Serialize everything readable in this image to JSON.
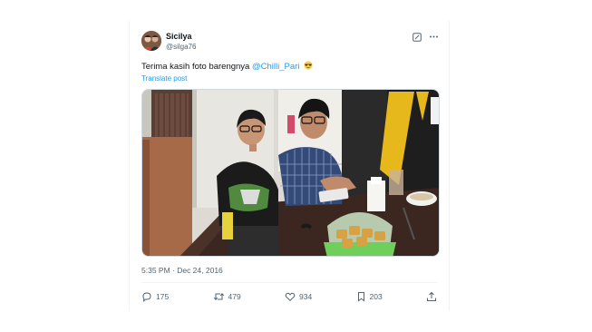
{
  "tweet": {
    "display_name": "Sicilya",
    "handle": "@silga76",
    "text_before": "Terima kasih foto barengnya ",
    "mention": "@Chilli_Pari",
    "emoji": "smiling-face-with-sunglasses",
    "translate_label": "Translate post",
    "timestamp": "5:35 PM · Dec 24, 2016"
  },
  "actions": {
    "replies": "175",
    "reposts": "479",
    "likes": "934",
    "bookmarks": "203"
  },
  "icons": [
    "grok-icon",
    "more-icon",
    "reply-icon",
    "repost-icon",
    "like-icon",
    "bookmark-icon",
    "share-icon"
  ],
  "colors": {
    "accent": "#1d9bf0",
    "text": "#0f1419",
    "muted": "#536471",
    "border": "#eff3f4"
  }
}
